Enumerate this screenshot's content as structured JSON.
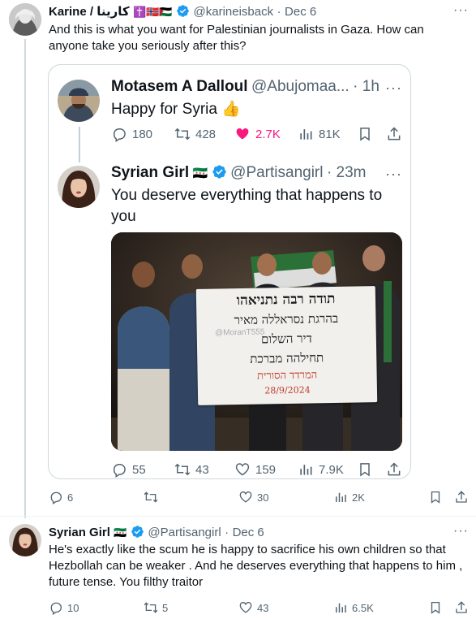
{
  "main_tweet": {
    "name": "Karine / كارينا",
    "flags": "✝️🇳🇴🇵🇸",
    "handle": "@karineisback",
    "separator": "·",
    "date": "Dec 6",
    "text": "And this is what you want for Palestinian journalists in Gaza. How can anyone take you seriously after this?",
    "more": "···",
    "stats": {
      "replies": "6",
      "retweets": "",
      "likes": "30",
      "views": "2K"
    }
  },
  "quoted": {
    "first": {
      "name": "Motasem A Dalloul",
      "handle": "@Abujomaa...",
      "time": "· 1h",
      "text": "Happy for Syria 👍",
      "more": "···",
      "stats": {
        "replies": "180",
        "retweets": "428",
        "likes": "2.7K",
        "views": "81K"
      }
    },
    "second": {
      "name": "Syrian Girl",
      "flag": "🇸🇾",
      "handle": "@Partisangirl",
      "time": "· 23m",
      "text": "You deserve everything that happens to you",
      "more": "···",
      "stats": {
        "replies": "55",
        "retweets": "43",
        "likes": "159",
        "views": "7.9K"
      }
    },
    "photo": {
      "sign_lines": [
        "תודה רבה נתניאהו",
        "בהרגת נסראללה מאיר",
        "דיר השלום",
        "תחילהה מברכת",
        "המרדד הסורית",
        "28/9/2024"
      ],
      "watermark": "@MoranT555"
    }
  },
  "reply_tweet": {
    "name": "Syrian Girl",
    "flag": "🇸🇾",
    "handle": "@Partisangirl",
    "separator": "·",
    "date": "Dec 6",
    "text": "He's exactly like the scum he is happy to sacrifice his own children so that Hezbollah can be weaker . And he deserves everything that happens to him , future tense. You filthy traitor",
    "more": "···",
    "stats": {
      "replies": "10",
      "retweets": "5",
      "likes": "43",
      "views": "6.5K"
    }
  },
  "colors": {
    "accent": "#1d9bf0",
    "like": "#f91880",
    "muted": "#536471",
    "border": "#cfd9de"
  }
}
